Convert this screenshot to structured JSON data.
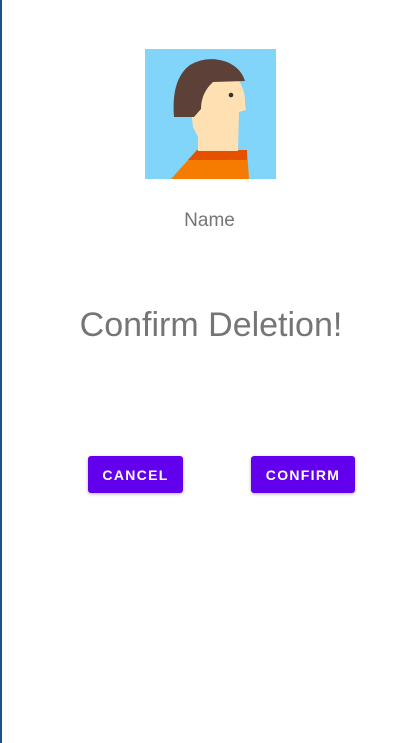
{
  "profile": {
    "name_label": "Name",
    "avatar_icon": "person-avatar-icon"
  },
  "dialog": {
    "title": "Confirm Deletion!"
  },
  "actions": {
    "cancel_label": "CANCEL",
    "confirm_label": "CONFIRM"
  },
  "colors": {
    "accent": "#6200ee",
    "text_secondary": "#757575",
    "avatar_background": "#81d4fa",
    "avatar_hair": "#5d4037",
    "avatar_skin": "#ffe0b2",
    "avatar_shirt": "#f57c00",
    "avatar_collar": "#e65100",
    "left_edge": "#1e4f8f"
  }
}
